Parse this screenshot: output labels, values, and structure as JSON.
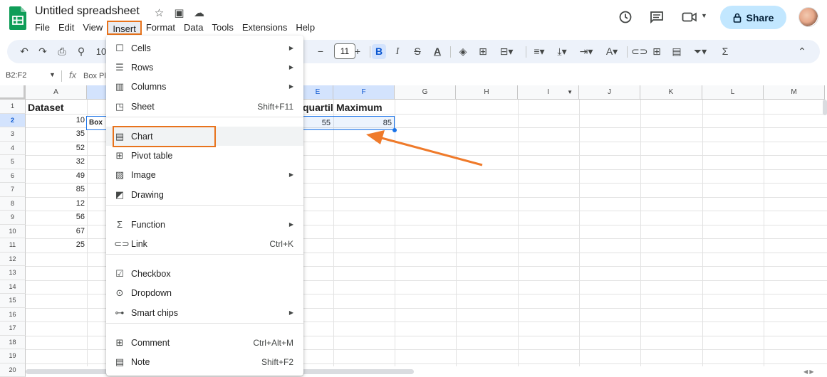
{
  "header": {
    "title": "Untitled spreadsheet",
    "menus": [
      "File",
      "Edit",
      "View",
      "Insert",
      "Format",
      "Data",
      "Tools",
      "Extensions",
      "Help"
    ],
    "active_menu": "Insert",
    "share_label": "Share"
  },
  "toolbar": {
    "zoom_partial": "10",
    "font_size": "11",
    "minus": "−",
    "plus": "+"
  },
  "formula_bar": {
    "name_box": "B2:F2",
    "fx": "fx",
    "content": "Box Plo"
  },
  "grid": {
    "columns": [
      "A",
      "",
      "",
      "",
      "E",
      "F",
      "G",
      "H",
      "I",
      "J",
      "K",
      "L",
      "M"
    ],
    "rows": [
      "1",
      "2",
      "3",
      "4",
      "5",
      "6",
      "7",
      "8",
      "9",
      "10",
      "11",
      "12",
      "13",
      "14",
      "15",
      "16",
      "17",
      "18",
      "19",
      "20"
    ],
    "a1": "Dataset",
    "e1": "quartil",
    "f1": "Maximum",
    "e2": "55",
    "f2": "85",
    "b2": "Box P",
    "column_a_values": [
      "10",
      "35",
      "52",
      "32",
      "49",
      "85",
      "12",
      "56",
      "67",
      "25"
    ]
  },
  "insert_menu": {
    "items": [
      {
        "label": "Cells",
        "icon": "cells-icon",
        "glyph": "☐",
        "arrow": true
      },
      {
        "label": "Rows",
        "icon": "rows-icon",
        "glyph": "☰",
        "arrow": true
      },
      {
        "label": "Columns",
        "icon": "columns-icon",
        "glyph": "▥",
        "arrow": true
      },
      {
        "label": "Sheet",
        "icon": "sheet-icon",
        "glyph": "◳",
        "shortcut": "Shift+F11"
      },
      {
        "label": "Chart",
        "icon": "chart-icon",
        "glyph": "▤"
      },
      {
        "label": "Pivot table",
        "icon": "pivot-table-icon",
        "glyph": "⊞"
      },
      {
        "label": "Image",
        "icon": "image-icon",
        "glyph": "▨",
        "arrow": true
      },
      {
        "label": "Drawing",
        "icon": "drawing-icon",
        "glyph": "◩"
      },
      {
        "label": "Function",
        "icon": "function-icon",
        "glyph": "Σ",
        "arrow": true
      },
      {
        "label": "Link",
        "icon": "link-icon",
        "glyph": "⊂⊃",
        "shortcut": "Ctrl+K"
      },
      {
        "label": "Checkbox",
        "icon": "checkbox-icon",
        "glyph": "☑"
      },
      {
        "label": "Dropdown",
        "icon": "dropdown-icon",
        "glyph": "⊙"
      },
      {
        "label": "Smart chips",
        "icon": "smart-chips-icon",
        "glyph": "⊶",
        "arrow": true
      },
      {
        "label": "Comment",
        "icon": "comment-icon",
        "glyph": "⊞",
        "shortcut": "Ctrl+Alt+M"
      },
      {
        "label": "Note",
        "icon": "note-icon",
        "glyph": "▤",
        "shortcut": "Shift+F2"
      }
    ]
  },
  "colors": {
    "accent": "#0b57d0",
    "highlight": "#e8731c",
    "share_bg": "#c2e7ff"
  }
}
